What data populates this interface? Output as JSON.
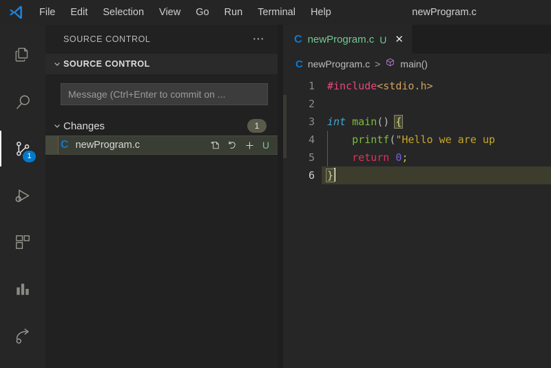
{
  "window": {
    "title": "newProgram.c"
  },
  "menubar": {
    "logo_icon": "vscode-logo-icon",
    "items": [
      {
        "label": "File"
      },
      {
        "label": "Edit"
      },
      {
        "label": "Selection"
      },
      {
        "label": "View"
      },
      {
        "label": "Go"
      },
      {
        "label": "Run"
      },
      {
        "label": "Terminal"
      },
      {
        "label": "Help"
      }
    ]
  },
  "activitybar": {
    "items": [
      {
        "name": "explorer",
        "icon": "files-icon",
        "active": false,
        "badge": ""
      },
      {
        "name": "search",
        "icon": "search-icon",
        "active": false,
        "badge": ""
      },
      {
        "name": "source-control",
        "icon": "source-control-icon",
        "active": true,
        "badge": "1"
      },
      {
        "name": "run-and-debug",
        "icon": "run-debug-icon",
        "active": false,
        "badge": ""
      },
      {
        "name": "extensions",
        "icon": "extensions-icon",
        "active": false,
        "badge": ""
      },
      {
        "name": "chart",
        "icon": "bar-chart-icon",
        "active": false,
        "badge": ""
      },
      {
        "name": "share",
        "icon": "share-arrow-icon",
        "active": false,
        "badge": ""
      }
    ]
  },
  "sidebar": {
    "title": "SOURCE CONTROL",
    "more_icon": "ellipsis-icon",
    "section": {
      "title": "SOURCE CONTROL",
      "chevron_icon": "chevron-down-icon"
    },
    "commit": {
      "placeholder": "Message (Ctrl+Enter to commit on ...",
      "value": ""
    },
    "changes": {
      "label": "Changes",
      "chevron_icon": "chevron-down-icon",
      "count": "1",
      "files": [
        {
          "name": "newProgram.c",
          "file_icon": "c-file-icon",
          "status": "U",
          "actions": [
            {
              "name": "open-file",
              "icon": "open-file-icon"
            },
            {
              "name": "discard-changes",
              "icon": "discard-icon"
            },
            {
              "name": "stage-changes",
              "icon": "plus-icon"
            }
          ]
        }
      ]
    }
  },
  "editor": {
    "tabs": [
      {
        "label": "newProgram.c",
        "file_icon": "c-file-icon",
        "status": "U",
        "close_icon": "close-icon",
        "active": true
      }
    ],
    "breadcrumb": {
      "file_icon": "c-file-icon",
      "file": "newProgram.c",
      "separator": ">",
      "symbol_icon": "method-symbol-icon",
      "symbol": "main()"
    },
    "gutter": [
      "1",
      "2",
      "3",
      "4",
      "5",
      "6"
    ],
    "active_line": 6,
    "code": {
      "line1_pp": "#include",
      "line1_inc": "<stdio.h>",
      "line3_kw": "int",
      "line3_fn": "main",
      "line3_parens": "()",
      "line3_brace": "{",
      "line4_fn": "printf",
      "line4_paren": "(",
      "line4_str": "\"Hello we are up",
      "line5_kw": "return",
      "line5_num": "0",
      "line5_semi": ";",
      "line6_brace": "}"
    },
    "colors": {
      "background": "#262626",
      "preprocessor": "#e8487e",
      "include_path": "#cfa15a",
      "keyword": "#3fa9cf",
      "function": "#7dbe3a",
      "string": "#c7a62b",
      "return_keyword": "#e0315c",
      "number": "#7a5fe0",
      "current_line": "#3d3d2d",
      "accent": "#007acc",
      "untracked": "#73c991"
    }
  }
}
